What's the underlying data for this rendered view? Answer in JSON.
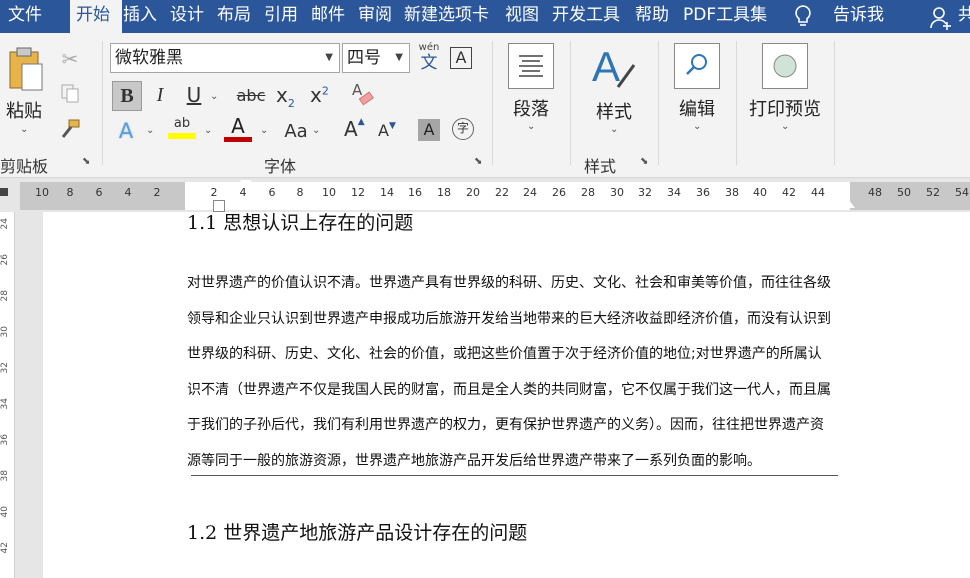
{
  "tabs": [
    {
      "label": "文件"
    },
    {
      "label": "开始"
    },
    {
      "label": "插入"
    },
    {
      "label": "设计"
    },
    {
      "label": "布局"
    },
    {
      "label": "引用"
    },
    {
      "label": "邮件"
    },
    {
      "label": "审阅"
    },
    {
      "label": "新建选项卡"
    },
    {
      "label": "视图"
    },
    {
      "label": "开发工具"
    },
    {
      "label": "帮助"
    },
    {
      "label": "PDF工具集"
    },
    {
      "label": "告诉我"
    },
    {
      "label": "共"
    }
  ],
  "clipboard": {
    "paste_label": "粘贴",
    "group_label": "剪贴板"
  },
  "font": {
    "name": "微软雅黑",
    "size": "四号",
    "phonetic_top": "wén",
    "phonetic_bottom": "文",
    "border_char": "A",
    "bold": "B",
    "italic": "I",
    "underline": "U",
    "strike": "abc",
    "subscript": "x",
    "subscript_sub": "2",
    "superscript": "x",
    "superscript_sup": "2",
    "clear": "A",
    "effects": "A",
    "highlight": "ab",
    "color": "A",
    "case": "Aa",
    "grow": "A",
    "shrink": "A",
    "shade": "A",
    "enclose": "字",
    "group_label": "字体",
    "highlight_color": "#ffff00",
    "font_color": "#c00000"
  },
  "paragraph": {
    "label": "段落"
  },
  "styles": {
    "label": "样式",
    "group_label": "样式"
  },
  "editing": {
    "label": "编辑"
  },
  "print_preview": {
    "label": "打印预览"
  },
  "ruler": {
    "ticks": [
      "10",
      "8",
      "6",
      "4",
      "2",
      "2",
      "4",
      "6",
      "8",
      "10",
      "12",
      "14",
      "16",
      "18",
      "20",
      "22",
      "24",
      "26",
      "28",
      "30",
      "32",
      "34",
      "36",
      "38",
      "40",
      "42",
      "44",
      "48",
      "50",
      "52",
      "54"
    ]
  },
  "vruler": {
    "ticks": [
      "24",
      "26",
      "28",
      "30",
      "32",
      "34",
      "36",
      "38",
      "40",
      "42"
    ]
  },
  "document": {
    "top_heading": "1.1  思想认识上存在的问题",
    "paragraph_lines": [
      "对世界遗产的价值认识不清。世界遗产具有世界级的科研、历史、文化、社会和审美等价值，而往往各级",
      "领导和企业只认识到世界遗产申报成功后旅游开发给当地带来的巨大经济收益即经济价值，而没有认识到",
      "世界级的科研、历史、文化、社会的价值，或把这些价值置于次于经济价值的地位;对世界遗产的所属认",
      "识不清（世界遗产不仅是我国人民的财富，而且是全人类的共同财富，它不仅属于我们这一代人，而且属",
      "于我们的子孙后代，我们有利用世界遗产的权力，更有保护世界遗产的义务）。因而，往往把世界遗产资",
      "源等同于一般的旅游资源，世界遗产地旅游产品开发后给世界遗产带来了一系列负面的影响。"
    ],
    "heading_2": "1.2  世界遗产地旅游产品设计存在的问题"
  }
}
